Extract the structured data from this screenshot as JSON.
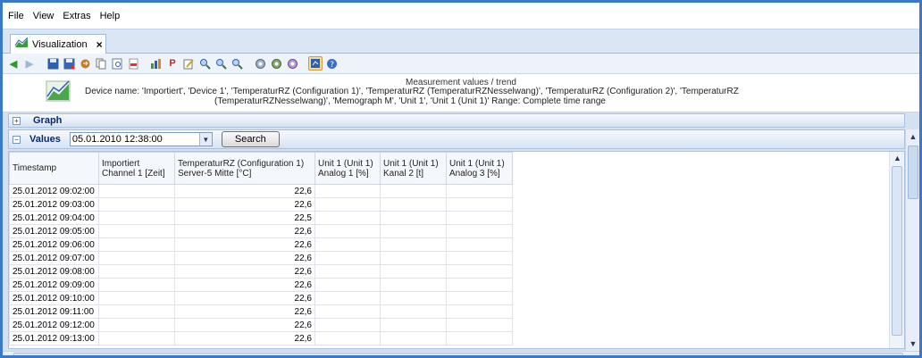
{
  "menu": {
    "file": "File",
    "view": "View",
    "extras": "Extras",
    "help": "Help"
  },
  "tab": {
    "label": "Visualization",
    "close": "×"
  },
  "header": {
    "title": "Measurement values / trend",
    "line2": "Device name: 'Importiert', 'Device 1', 'TemperaturRZ (Configuration 1)', 'TemperaturRZ (TemperaturRZNesselwang)', 'TemperaturRZ (Configuration 2)', 'TemperaturRZ",
    "line3": "(TemperaturRZNesselwang)', 'Memograph M', 'Unit 1', 'Unit 1 (Unit 1)'   Range: Complete time range"
  },
  "sections": {
    "graph": "Graph",
    "values": "Values",
    "graph_toggle": "+",
    "values_toggle": "−"
  },
  "values_bar": {
    "date": "05.01.2010 12:38:00",
    "search": "Search"
  },
  "table": {
    "headers": [
      "Timestamp",
      "Importiert Channel 1 [Zeit]",
      "TemperaturRZ (Configuration 1) Server-5 Mitte [°C]",
      "Unit 1 (Unit 1) Analog 1 [%]",
      "Unit 1 (Unit 1) Kanal 2 [t]",
      "Unit 1 (Unit 1) Analog 3 [%]"
    ],
    "rows": [
      [
        "25.01.2012 09:02:00",
        "",
        "22,6",
        "",
        "",
        ""
      ],
      [
        "25.01.2012 09:03:00",
        "",
        "22,6",
        "",
        "",
        ""
      ],
      [
        "25.01.2012 09:04:00",
        "",
        "22,5",
        "",
        "",
        ""
      ],
      [
        "25.01.2012 09:05:00",
        "",
        "22,6",
        "",
        "",
        ""
      ],
      [
        "25.01.2012 09:06:00",
        "",
        "22,6",
        "",
        "",
        ""
      ],
      [
        "25.01.2012 09:07:00",
        "",
        "22,6",
        "",
        "",
        ""
      ],
      [
        "25.01.2012 09:08:00",
        "",
        "22,6",
        "",
        "",
        ""
      ],
      [
        "25.01.2012 09:09:00",
        "",
        "22,6",
        "",
        "",
        ""
      ],
      [
        "25.01.2012 09:10:00",
        "",
        "22,6",
        "",
        "",
        ""
      ],
      [
        "25.01.2012 09:11:00",
        "",
        "22,6",
        "",
        "",
        ""
      ],
      [
        "25.01.2012 09:12:00",
        "",
        "22,6",
        "",
        "",
        ""
      ],
      [
        "25.01.2012 09:13:00",
        "",
        "22,6",
        "",
        "",
        ""
      ]
    ]
  },
  "colors": {
    "accent": "#3a78c8",
    "section_text": "#0a2a6e"
  }
}
